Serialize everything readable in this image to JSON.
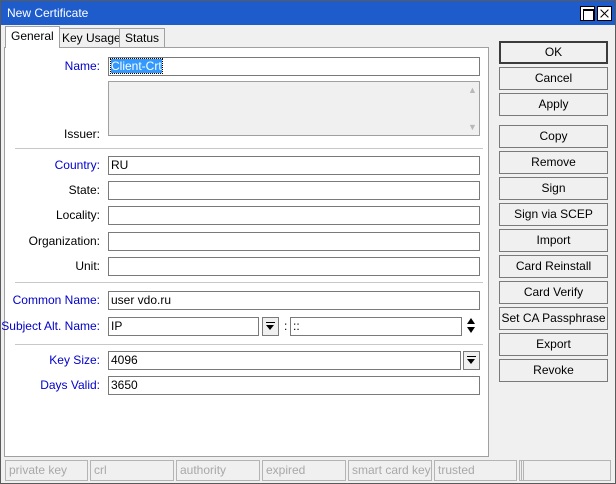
{
  "window": {
    "title": "New Certificate"
  },
  "tabs": [
    {
      "label": "General",
      "active": true
    },
    {
      "label": "Key Usage",
      "active": false
    },
    {
      "label": "Status",
      "active": false
    }
  ],
  "form": {
    "name": {
      "label": "Name:",
      "value": "Client-Crt"
    },
    "issuer": {
      "label": "Issuer:",
      "value": ""
    },
    "country": {
      "label": "Country:",
      "value": "RU"
    },
    "state": {
      "label": "State:",
      "value": ""
    },
    "locality": {
      "label": "Locality:",
      "value": ""
    },
    "organization": {
      "label": "Organization:",
      "value": ""
    },
    "unit": {
      "label": "Unit:",
      "value": ""
    },
    "common_name": {
      "label": "Common Name:",
      "value": "user vdo.ru"
    },
    "subject_alt_name": {
      "label": "Subject Alt. Name:",
      "type": "IP",
      "separator": ":",
      "value": "::"
    },
    "key_size": {
      "label": "Key Size:",
      "value": "4096"
    },
    "days_valid": {
      "label": "Days Valid:",
      "value": "3650"
    }
  },
  "buttons": {
    "ok": "OK",
    "cancel": "Cancel",
    "apply": "Apply",
    "copy": "Copy",
    "remove": "Remove",
    "sign": "Sign",
    "sign_via_scep": "Sign via SCEP",
    "import": "Import",
    "card_reinstall": "Card Reinstall",
    "card_verify": "Card Verify",
    "set_ca_passphrase": "Set CA Passphrase",
    "export": "Export",
    "revoke": "Revoke"
  },
  "statusbar": [
    "private key",
    "crl",
    "authority",
    "expired",
    "smart card key",
    "trusted",
    "",
    ""
  ],
  "colors": {
    "titlebar": "#1e5ccc",
    "label_blue": "#0000cc",
    "selection": "#3399ff"
  }
}
